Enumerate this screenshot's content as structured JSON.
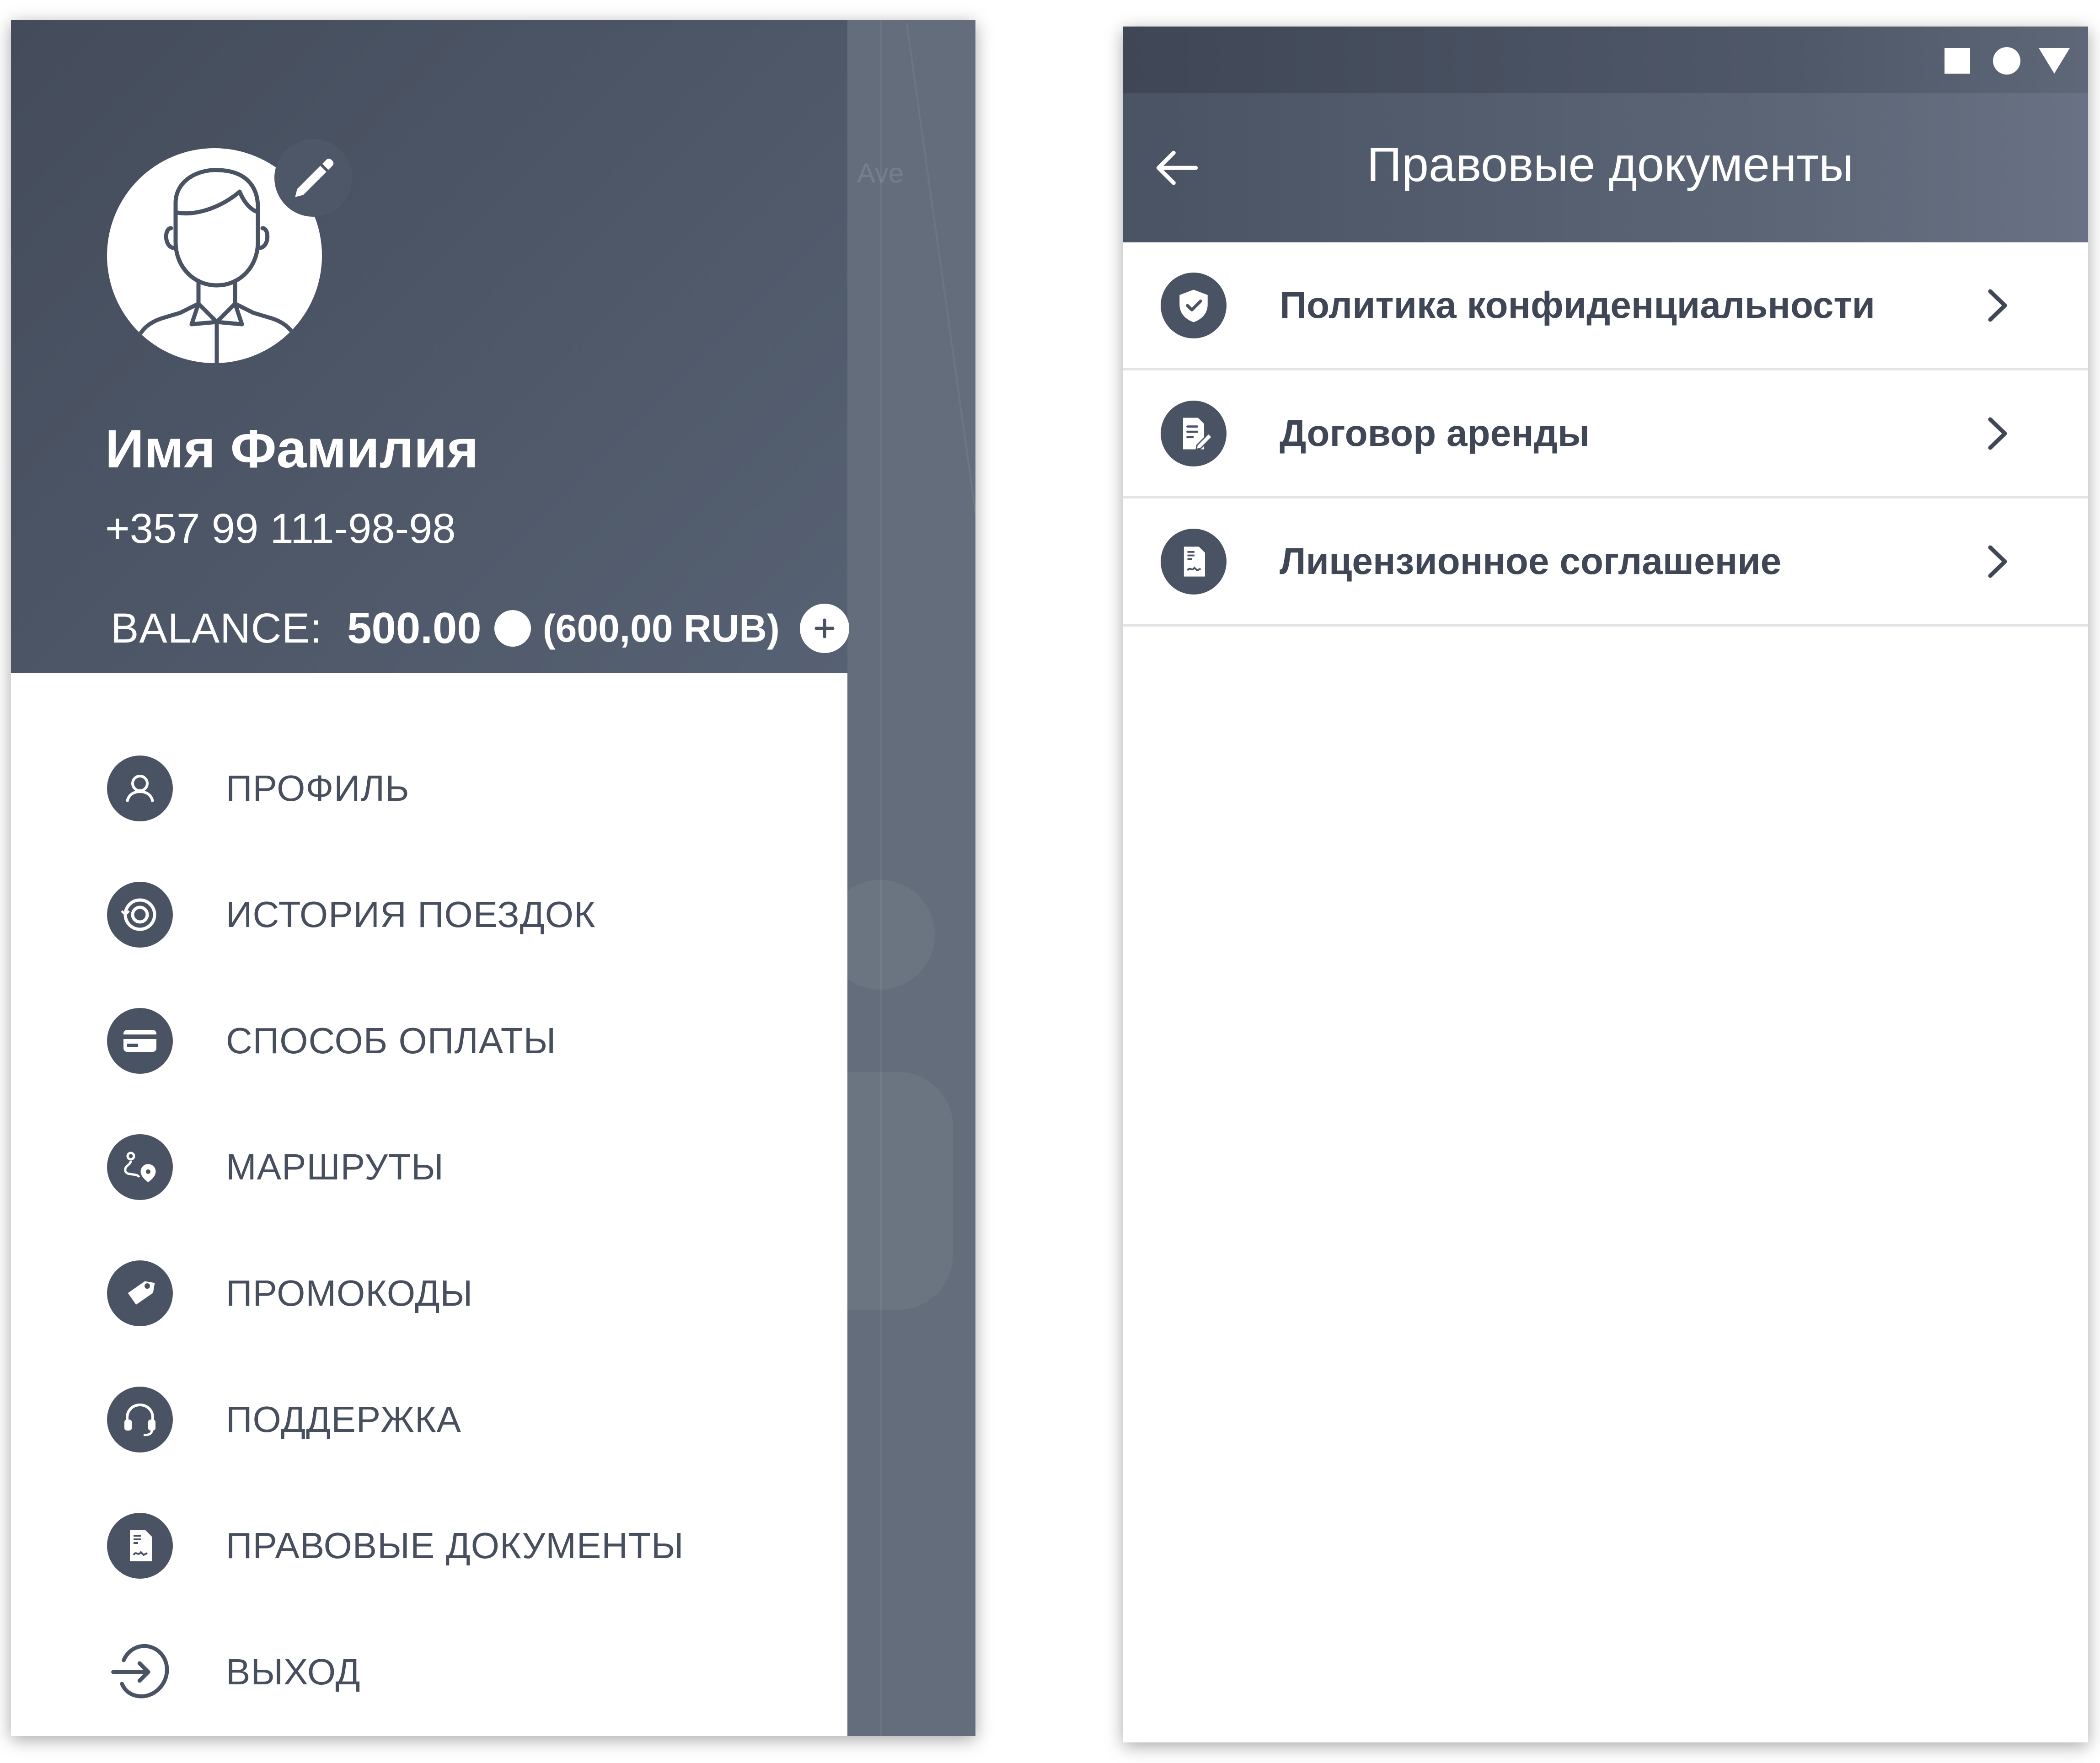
{
  "drawer": {
    "user_name": "Имя Фамилия",
    "phone": "+357 99 111-98-98",
    "balance": {
      "label": "BALANCE:",
      "amount": "500.00",
      "rub": "(600,00 RUB)"
    },
    "menu": [
      {
        "label": "ПРОФИЛЬ",
        "icon": "user-icon"
      },
      {
        "label": "ИСТОРИЯ ПОЕЗДОК",
        "icon": "history-icon"
      },
      {
        "label": "СПОСОБ ОПЛАТЫ",
        "icon": "credit-card-icon"
      },
      {
        "label": "МАРШРУТЫ",
        "icon": "route-icon"
      },
      {
        "label": "ПРОМОКОДЫ",
        "icon": "tag-icon"
      },
      {
        "label": "ПОДДЕРЖКА",
        "icon": "headset-icon"
      },
      {
        "label": "ПРАВОВЫЕ ДОКУМЕНТЫ",
        "icon": "document-icon"
      },
      {
        "label": "ВЫХОД",
        "icon": "logout-icon"
      }
    ]
  },
  "map": {
    "street_label": "Ave"
  },
  "legal": {
    "title": "Правовые документы",
    "items": [
      {
        "label": "Политика конфиденциальности",
        "icon": "shield-check-icon"
      },
      {
        "label": "Договор аренды",
        "icon": "document-edit-icon"
      },
      {
        "label": "Лицензионное соглашение",
        "icon": "document-icon"
      }
    ]
  },
  "colors": {
    "header_dark": "#444c5b",
    "header_light": "#566173",
    "icon_circle": "#4a5363",
    "text": "#3f4756",
    "divider": "#e2e4e8"
  }
}
